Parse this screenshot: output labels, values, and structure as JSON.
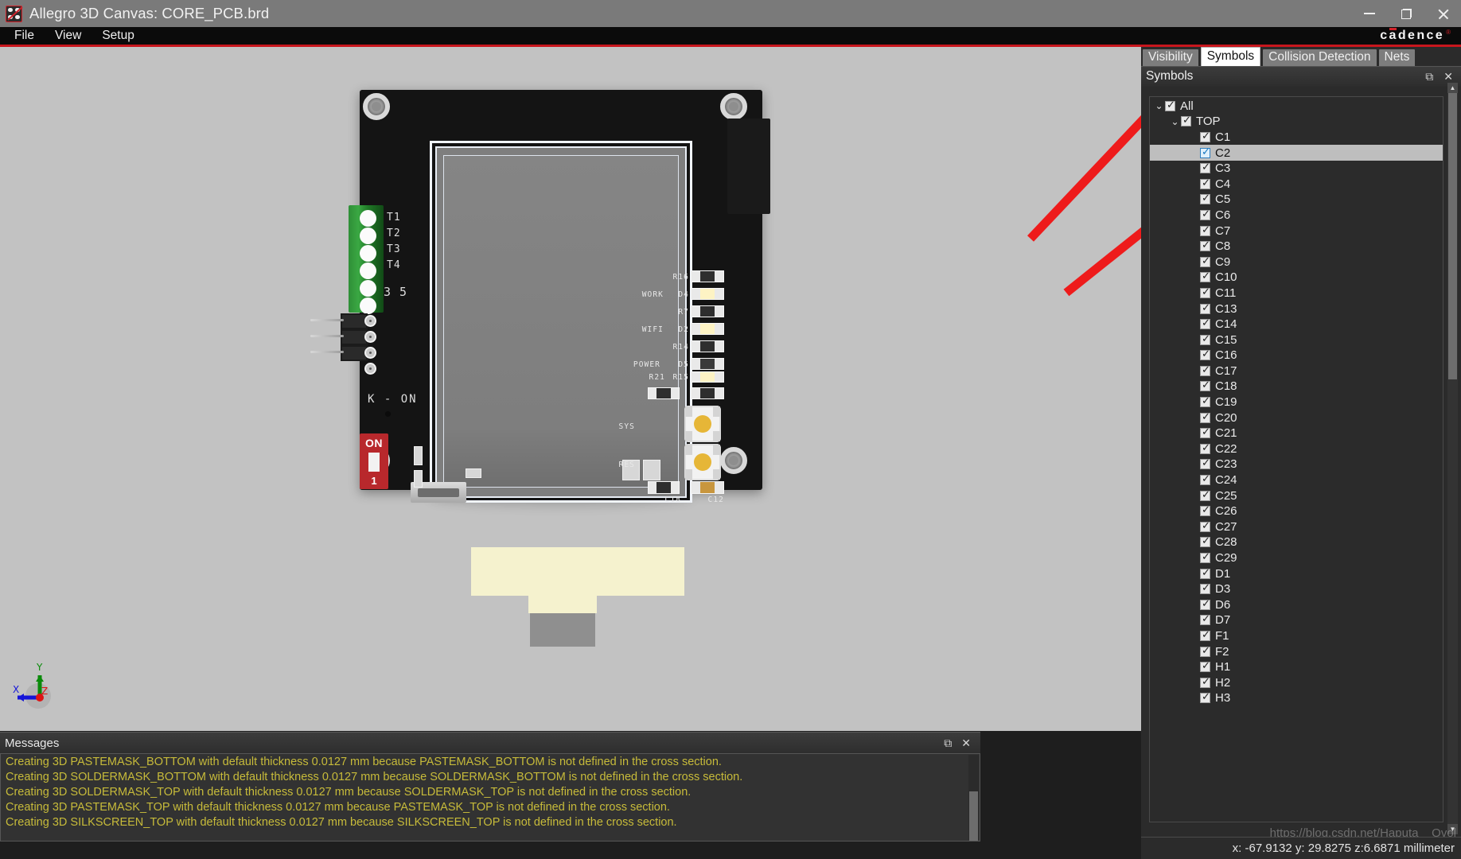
{
  "window": {
    "title": "Allegro 3D Canvas: CORE_PCB.brd",
    "app_icon": "allegro-dice-icon",
    "minimize": "—",
    "maximize": "❐",
    "close": "✕"
  },
  "menu": {
    "items": [
      "File",
      "View",
      "Setup"
    ],
    "brand": "cadence",
    "brand_mark": "®"
  },
  "dock": {
    "tabs": [
      {
        "label": "Visibility",
        "active": false
      },
      {
        "label": "Symbols",
        "active": true
      },
      {
        "label": "Collision Detection",
        "active": false
      },
      {
        "label": "Nets",
        "active": false
      }
    ],
    "panel_title": "Symbols",
    "undock_icon": "undock-icon",
    "close_icon": "close-icon",
    "tree": [
      {
        "label": "All",
        "level": 1,
        "checked": true,
        "expanded": true,
        "selected": false
      },
      {
        "label": "TOP",
        "level": 2,
        "checked": true,
        "expanded": true,
        "selected": false
      },
      {
        "label": "C1",
        "level": 3,
        "checked": true,
        "selected": false
      },
      {
        "label": "C2",
        "level": 3,
        "checked": true,
        "selected": true
      },
      {
        "label": "C3",
        "level": 3,
        "checked": true,
        "selected": false
      },
      {
        "label": "C4",
        "level": 3,
        "checked": true,
        "selected": false
      },
      {
        "label": "C5",
        "level": 3,
        "checked": true,
        "selected": false
      },
      {
        "label": "C6",
        "level": 3,
        "checked": true,
        "selected": false
      },
      {
        "label": "C7",
        "level": 3,
        "checked": true,
        "selected": false
      },
      {
        "label": "C8",
        "level": 3,
        "checked": true,
        "selected": false
      },
      {
        "label": "C9",
        "level": 3,
        "checked": true,
        "selected": false
      },
      {
        "label": "C10",
        "level": 3,
        "checked": true,
        "selected": false
      },
      {
        "label": "C11",
        "level": 3,
        "checked": true,
        "selected": false
      },
      {
        "label": "C13",
        "level": 3,
        "checked": true,
        "selected": false
      },
      {
        "label": "C14",
        "level": 3,
        "checked": true,
        "selected": false
      },
      {
        "label": "C15",
        "level": 3,
        "checked": true,
        "selected": false
      },
      {
        "label": "C16",
        "level": 3,
        "checked": true,
        "selected": false
      },
      {
        "label": "C17",
        "level": 3,
        "checked": true,
        "selected": false
      },
      {
        "label": "C18",
        "level": 3,
        "checked": true,
        "selected": false
      },
      {
        "label": "C19",
        "level": 3,
        "checked": true,
        "selected": false
      },
      {
        "label": "C20",
        "level": 3,
        "checked": true,
        "selected": false
      },
      {
        "label": "C21",
        "level": 3,
        "checked": true,
        "selected": false
      },
      {
        "label": "C22",
        "level": 3,
        "checked": true,
        "selected": false
      },
      {
        "label": "C23",
        "level": 3,
        "checked": true,
        "selected": false
      },
      {
        "label": "C24",
        "level": 3,
        "checked": true,
        "selected": false
      },
      {
        "label": "C25",
        "level": 3,
        "checked": true,
        "selected": false
      },
      {
        "label": "C26",
        "level": 3,
        "checked": true,
        "selected": false
      },
      {
        "label": "C27",
        "level": 3,
        "checked": true,
        "selected": false
      },
      {
        "label": "C28",
        "level": 3,
        "checked": true,
        "selected": false
      },
      {
        "label": "C29",
        "level": 3,
        "checked": true,
        "selected": false
      },
      {
        "label": "D1",
        "level": 3,
        "checked": true,
        "selected": false
      },
      {
        "label": "D3",
        "level": 3,
        "checked": true,
        "selected": false
      },
      {
        "label": "D6",
        "level": 3,
        "checked": true,
        "selected": false
      },
      {
        "label": "D7",
        "level": 3,
        "checked": true,
        "selected": false
      },
      {
        "label": "F1",
        "level": 3,
        "checked": true,
        "selected": false
      },
      {
        "label": "F2",
        "level": 3,
        "checked": true,
        "selected": false
      },
      {
        "label": "H1",
        "level": 3,
        "checked": true,
        "selected": false
      },
      {
        "label": "H2",
        "level": 3,
        "checked": true,
        "selected": false
      },
      {
        "label": "H3",
        "level": 3,
        "checked": true,
        "selected": false
      }
    ]
  },
  "status": {
    "coords": "x: -67.9132 y: 29.8275 z:6.6871 millimeter",
    "watermark": "https://blog.csdn.net/Haputa__Qvol"
  },
  "messages": {
    "title": "Messages",
    "undock_icon": "undock-icon",
    "close_icon": "close-icon",
    "lines": [
      "Creating 3D PASTEMASK_BOTTOM with default thickness 0.0127 mm because PASTEMASK_BOTTOM is not defined in the cross section.",
      "Creating 3D SOLDERMASK_BOTTOM with default thickness 0.0127 mm because SOLDERMASK_BOTTOM is not defined in the cross section.",
      "Creating 3D SOLDERMASK_TOP with default thickness 0.0127 mm because SOLDERMASK_TOP is not defined in the cross section.",
      "Creating 3D PASTEMASK_TOP with default thickness 0.0127 mm because PASTEMASK_TOP is not defined in the cross section.",
      "Creating 3D SILKSCREEN_TOP with default thickness 0.0127 mm because SILKSCREEN_TOP is not defined in the cross section."
    ]
  },
  "canvas": {
    "axis": {
      "x": "X",
      "y": "Y",
      "z": "Z"
    },
    "silkscreen": {
      "terminal_labels": [
        "T1",
        "T2",
        "T3",
        "T4",
        "3 5"
      ],
      "k_on": "K - ON",
      "dip_on": "ON",
      "dip_num": "1",
      "right_column": [
        "R16",
        "WORK",
        "D4",
        "R7",
        "WIFI",
        "D2",
        "R14",
        "POWER",
        "D5",
        "R21",
        "R15",
        "SYS",
        "RES",
        "C18",
        "C12"
      ]
    }
  },
  "colors": {
    "accent_red": "#c8161d",
    "titlebar": "#7a7a7a",
    "canvas_bg": "#c2c2c2",
    "panel_bg": "#2b2b2b",
    "message_text": "#c7bb3a",
    "board": "#141414",
    "terminal_green": "#3aa843",
    "dip_red": "#b8282c",
    "arrow_red": "#ee1b1b"
  }
}
